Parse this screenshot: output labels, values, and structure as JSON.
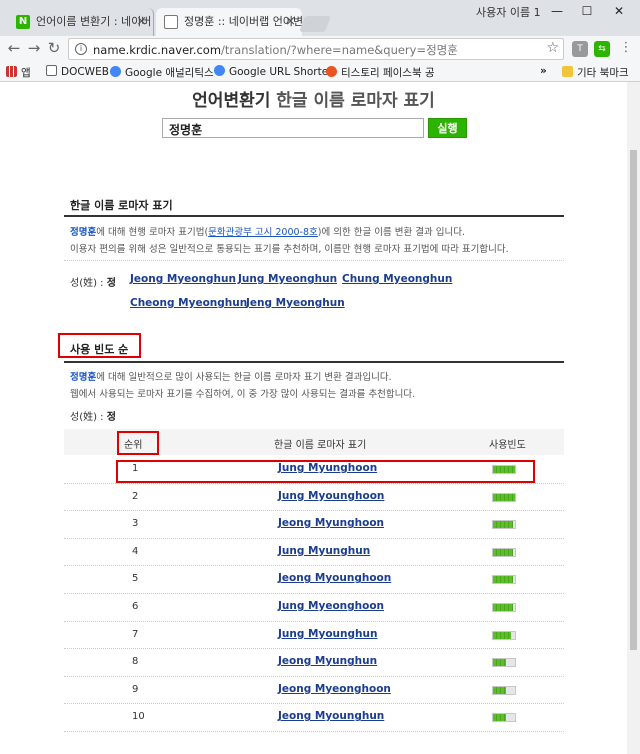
{
  "browser": {
    "tabs": [
      {
        "title": "언어이름 변환기 : 네이버",
        "favicon": "N"
      },
      {
        "title": "정명훈 :: 네이버랩 언어변"
      }
    ],
    "window_user": "사용자 이름 1",
    "url_host": "name.krdic.naver.com",
    "url_rest": "/translation/?where=name&query=정명훈",
    "bookmarks": [
      "앱",
      "DOCWEB",
      "Google 애널리틱스",
      "Google URL Shorten",
      "티스토리 페이스북 공"
    ],
    "bookmarks_more": "»",
    "other_bookmarks": "기타 북마크"
  },
  "page": {
    "title_main": "언어변환기",
    "title_sub": "한글 이름 로마자 표기",
    "search_value": "정명훈",
    "run_button": "실행",
    "section1": {
      "title": "한글 이름 로마자 표기",
      "name": "정명훈",
      "line1_a": "에 대해 현행 로마자 표기법(",
      "law_link": "문화관광부 고시 2000-8호",
      "line1_b": ")에 의한 한글 이름 변환 결과 입니다.",
      "line2": "이용자 편의를 위해 성은 일반적으로 통용되는 표기를 추천하며, 이름만 현행 로마자 표기법에 따라 표기합니다.",
      "surname_label": "성(姓) :",
      "surname": "정",
      "romanizations": [
        "Jeong Myeonghun",
        "Jung Myeonghun",
        "Chung Myeonghun",
        "Cheong Myeonghun",
        "Jeng Myeonghun"
      ]
    },
    "section2": {
      "title": "사용 빈도 순",
      "name": "정명훈",
      "line1": "에 대해 일반적으로 많이 사용되는 한글 이름 로마자 표기 변환 결과입니다.",
      "line2": "웹에서 사용되는 로마자 표기를 수집하여, 이 중 가장 많이 사용되는 결과를 추천합니다.",
      "surname_label": "성(姓) :",
      "surname": "정",
      "columns": [
        "순위",
        "한글 이름 로마자 표기",
        "사용빈도"
      ],
      "rows": [
        {
          "rank": "1",
          "name": "Jung Myunghoon",
          "freq": 1.0
        },
        {
          "rank": "2",
          "name": "Jung Myounghoon",
          "freq": 1.0
        },
        {
          "rank": "3",
          "name": "Jeong Myunghoon",
          "freq": 0.9
        },
        {
          "rank": "4",
          "name": "Jung Myunghun",
          "freq": 0.9
        },
        {
          "rank": "5",
          "name": "Jeong Myounghoon",
          "freq": 0.9
        },
        {
          "rank": "6",
          "name": "Jung Myeonghoon",
          "freq": 0.9
        },
        {
          "rank": "7",
          "name": "Jung Myounghun",
          "freq": 0.8
        },
        {
          "rank": "8",
          "name": "Jeong Myunghun",
          "freq": 0.6
        },
        {
          "rank": "9",
          "name": "Jeong Myeonghoon",
          "freq": 0.6
        },
        {
          "rank": "10",
          "name": "Jeong Myounghun",
          "freq": 0.6
        }
      ]
    }
  },
  "colors": {
    "accent_green": "#2db400",
    "link_blue": "#1a3d8f",
    "highlight_red": "#e00000"
  }
}
